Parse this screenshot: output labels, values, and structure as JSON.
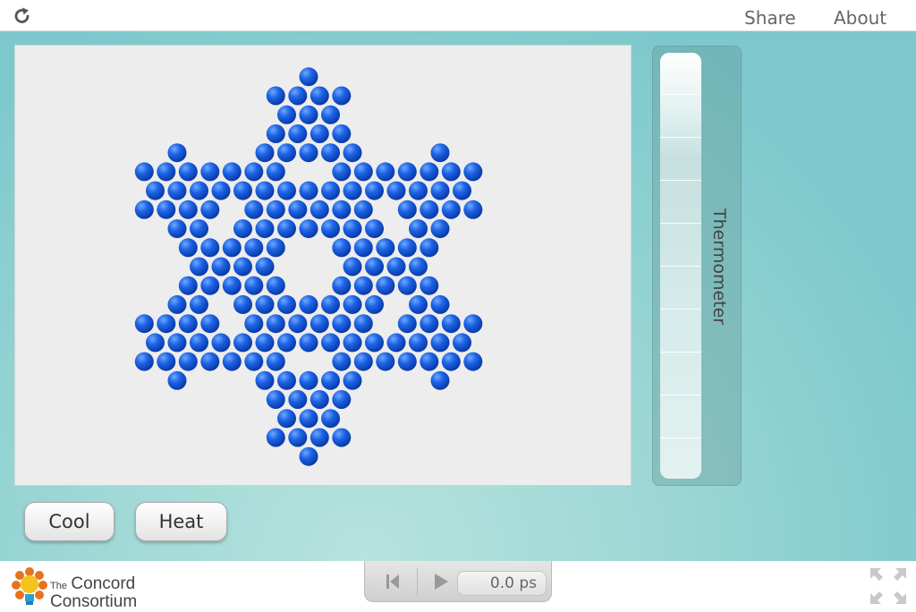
{
  "header": {
    "reload_icon": "reload-icon",
    "share_label": "Share",
    "about_label": "About"
  },
  "simulation": {
    "particle_color": "#1a5fe0",
    "background": "#ededed"
  },
  "thermometer": {
    "label": "Thermometer"
  },
  "controls": {
    "cool_label": "Cool",
    "heat_label": "Heat"
  },
  "footer": {
    "logo_the": "The",
    "logo_line1": "Concord",
    "logo_line2": "Consortium",
    "time_display": "0.0 ps"
  }
}
